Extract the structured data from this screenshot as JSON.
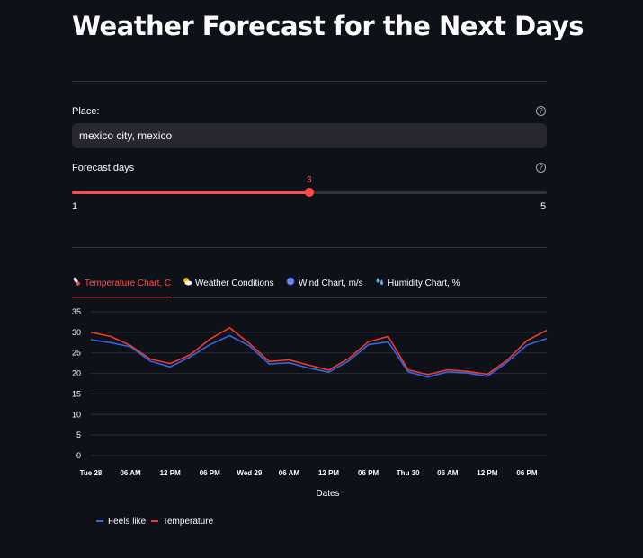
{
  "page": {
    "title": "Weather Forecast for the Next Days"
  },
  "place": {
    "label": "Place:",
    "value": "mexico city, mexico",
    "help": "?"
  },
  "days": {
    "label": "Forecast days",
    "help": "?",
    "min": 1,
    "max": 5,
    "value": 3,
    "min_label": "1",
    "max_label": "5",
    "value_label": "3"
  },
  "tabs": [
    {
      "label": "Temperature Chart, C",
      "icon": "thermometer-icon",
      "active": true
    },
    {
      "label": "Weather Conditions",
      "icon": "sun-behind-cloud-icon",
      "active": false
    },
    {
      "label": "Wind Chart, m/s",
      "icon": "cyclone-icon",
      "active": false
    },
    {
      "label": "Humidity Chart, %",
      "icon": "droplets-icon",
      "active": false
    }
  ],
  "colors": {
    "accent": "#ff4b4b",
    "background": "#0e1117",
    "feels_like": "#3366e6",
    "temperature": "#f03a2e"
  },
  "chart_data": {
    "type": "line",
    "xlabel": "Dates",
    "ylabel": "",
    "ylim": [
      0,
      35
    ],
    "y_ticks": [
      0,
      5,
      10,
      15,
      20,
      25,
      30,
      35
    ],
    "grid": true,
    "legend_position": "bottom-left",
    "x_tick_labels": [
      {
        "label": "Tue 28",
        "index": 0
      },
      {
        "label": "06 AM",
        "index": 2
      },
      {
        "label": "12 PM",
        "index": 4
      },
      {
        "label": "06 PM",
        "index": 6
      },
      {
        "label": "Wed 29",
        "index": 8
      },
      {
        "label": "06 AM",
        "index": 10
      },
      {
        "label": "12 PM",
        "index": 12
      },
      {
        "label": "06 PM",
        "index": 14
      },
      {
        "label": "Thu 30",
        "index": 16
      },
      {
        "label": "06 AM",
        "index": 18
      },
      {
        "label": "12 PM",
        "index": 20
      },
      {
        "label": "06 PM",
        "index": 22
      }
    ],
    "series": [
      {
        "name": "Feels like",
        "values": [
          28.2,
          27.5,
          26.5,
          23.0,
          21.6,
          24.0,
          27.0,
          29.2,
          26.7,
          22.3,
          22.6,
          21.3,
          20.3,
          23.0,
          27.0,
          27.7,
          20.4,
          19.1,
          20.4,
          20.1,
          19.3,
          22.7,
          26.9,
          28.5
        ]
      },
      {
        "name": "Temperature",
        "values": [
          30.0,
          29.0,
          26.8,
          23.5,
          22.4,
          24.5,
          28.3,
          31.1,
          27.3,
          22.9,
          23.3,
          22.0,
          20.8,
          23.6,
          27.7,
          29.0,
          20.9,
          19.7,
          20.9,
          20.5,
          19.8,
          23.2,
          28.0,
          30.5
        ]
      }
    ]
  }
}
